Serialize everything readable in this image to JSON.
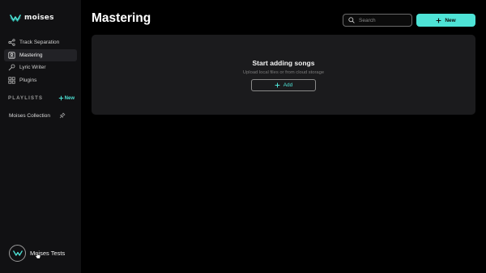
{
  "brand": {
    "name": "moises",
    "accent": "#4ee3d6"
  },
  "sidebar": {
    "items": [
      {
        "label": "Track Separation",
        "icon": "share-nodes-icon",
        "active": false
      },
      {
        "label": "Mastering",
        "icon": "mastering-icon",
        "active": true
      },
      {
        "label": "Lyric Writer",
        "icon": "microphone-icon",
        "active": false
      },
      {
        "label": "Plugins",
        "icon": "grid-icon",
        "active": false
      }
    ],
    "playlists": {
      "title": "PLAYLISTS",
      "new_label": "New",
      "items": [
        {
          "label": "Moises Collection",
          "icon": "pin-icon"
        }
      ]
    },
    "user": {
      "name": "Moises Tests"
    }
  },
  "header": {
    "title": "Mastering",
    "search_placeholder": "Search",
    "new_label": "New"
  },
  "dropzone": {
    "title": "Start adding songs",
    "subtitle": "Upload local files or from cloud storage",
    "add_label": "Add"
  }
}
